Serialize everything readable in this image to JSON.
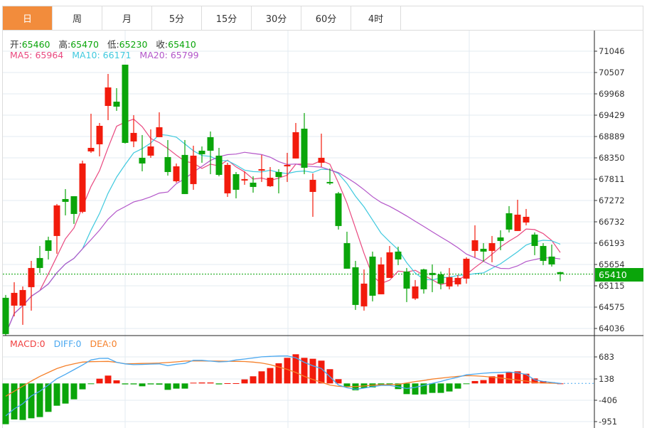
{
  "tabs": [
    "日",
    "周",
    "月",
    "5分",
    "15分",
    "30分",
    "60分",
    "4时"
  ],
  "active_tab": 0,
  "ohlc": {
    "open_label": "开:",
    "open": "65460",
    "high_label": "高:",
    "high": "65470",
    "low_label": "低:",
    "low": "65230",
    "close_label": "收:",
    "close": "65410"
  },
  "ma": {
    "ma5": "MA5: 65964",
    "ma10": "MA10: 66171",
    "ma20": "MA20: 65799"
  },
  "macd_legend": {
    "macd": "MACD:0",
    "diff": "DIFF:0",
    "dea": "DEA:0"
  },
  "current_price": "65410",
  "colors": {
    "up": "#f21b0c",
    "down": "#0aa50a",
    "ma5": "#e9487f",
    "ma10": "#3fc9de",
    "ma20": "#b356c9",
    "diff": "#4aa8f0",
    "dea": "#f5802a",
    "accent": "#f28c3c"
  },
  "chart_data": [
    {
      "type": "candlestick",
      "title": "K-line (daily)",
      "ylim": [
        64036,
        71046
      ],
      "yticks": [
        "71046",
        "70507",
        "69968",
        "69429",
        "68889",
        "68350",
        "67811",
        "67272",
        "66732",
        "66193",
        "65654",
        "65115",
        "64575",
        "64036"
      ],
      "ma_periods": [
        5,
        10,
        20
      ],
      "candles_ochl_note": "each entry [open, close, high, low]",
      "candles": [
        [
          64811,
          63894,
          64883,
          63858
        ],
        [
          64613,
          64936,
          65206,
          64343
        ],
        [
          64613,
          65008,
          65098,
          64128
        ],
        [
          65080,
          65565,
          65745,
          64487
        ],
        [
          65817,
          65565,
          66122,
          65440
        ],
        [
          66266,
          65997,
          66356,
          65781
        ],
        [
          66374,
          67147,
          67183,
          65925
        ],
        [
          67308,
          67237,
          67560,
          66895
        ],
        [
          67380,
          66931,
          67380,
          66679
        ],
        [
          66985,
          68207,
          68279,
          66949
        ],
        [
          68512,
          68602,
          69465,
          68476
        ],
        [
          68692,
          69159,
          69231,
          68387
        ],
        [
          69662,
          70130,
          70471,
          69303
        ],
        [
          69770,
          69644,
          70112,
          69537
        ],
        [
          70705,
          68728,
          70705,
          68710
        ],
        [
          68764,
          68980,
          69429,
          68620
        ],
        [
          68351,
          68207,
          68926,
          68009
        ],
        [
          68405,
          68638,
          69069,
          68351
        ],
        [
          68872,
          69123,
          69501,
          68872
        ],
        [
          68369,
          67991,
          68800,
          67901
        ],
        [
          67758,
          68135,
          68207,
          67722
        ],
        [
          68423,
          67434,
          68800,
          67434
        ],
        [
          67686,
          68405,
          68656,
          67542
        ],
        [
          68530,
          68441,
          68638,
          68225
        ],
        [
          68872,
          68530,
          69016,
          67937
        ],
        [
          68405,
          67919,
          68602,
          67883
        ],
        [
          67452,
          68171,
          68225,
          67362
        ],
        [
          67937,
          67542,
          67991,
          67326
        ],
        [
          67776,
          67812,
          68009,
          67668
        ],
        [
          67722,
          67614,
          67883,
          67470
        ],
        [
          68027,
          68063,
          68423,
          67740
        ],
        [
          67632,
          67847,
          68117,
          67614
        ],
        [
          67991,
          67865,
          68063,
          67452
        ],
        [
          68135,
          68171,
          68476,
          67740
        ],
        [
          68333,
          68998,
          69231,
          68333
        ],
        [
          69087,
          68099,
          69483,
          67937
        ],
        [
          67488,
          67794,
          67955,
          66859
        ],
        [
          68225,
          68351,
          68962,
          68117
        ],
        [
          67740,
          67704,
          68081,
          67668
        ],
        [
          67452,
          66626,
          67488,
          66536
        ],
        [
          66194,
          65547,
          66482,
          65547
        ],
        [
          65583,
          64631,
          65745,
          64505
        ],
        [
          64595,
          65170,
          65529,
          64487
        ],
        [
          65853,
          64864,
          65979,
          64721
        ],
        [
          64900,
          65655,
          65835,
          64900
        ],
        [
          65314,
          65961,
          66122,
          65314
        ],
        [
          65979,
          65781,
          66104,
          65637
        ],
        [
          65475,
          65044,
          65565,
          64703
        ],
        [
          64793,
          65098,
          65260,
          64757
        ],
        [
          65529,
          65026,
          65547,
          64918
        ],
        [
          65440,
          65386,
          65655,
          64954
        ],
        [
          65404,
          65170,
          65475,
          65026
        ],
        [
          65098,
          65332,
          65565,
          65026
        ],
        [
          65152,
          65314,
          65386,
          65098
        ],
        [
          65296,
          65799,
          65835,
          65170
        ],
        [
          65997,
          66266,
          66644,
          65835
        ],
        [
          66050,
          65979,
          66194,
          65727
        ],
        [
          65997,
          66194,
          66374,
          65709
        ],
        [
          66338,
          66248,
          66518,
          66015
        ],
        [
          66949,
          66536,
          67129,
          66464
        ],
        [
          66500,
          66913,
          67290,
          66500
        ],
        [
          66715,
          66859,
          67057,
          66644
        ],
        [
          66410,
          66122,
          66464,
          65889
        ],
        [
          66122,
          65745,
          66194,
          65637
        ],
        [
          65853,
          65655,
          66158,
          65601
        ],
        [
          65460,
          65410,
          65470,
          65230
        ]
      ]
    },
    {
      "type": "macd",
      "ylim": [
        -951,
        683
      ],
      "yticks": [
        "683",
        "138",
        "-406",
        "-951"
      ],
      "histogram": [
        -1042,
        -921,
        -933,
        -891,
        -860,
        -727,
        -570,
        -515,
        -406,
        -151,
        -12,
        121,
        200,
        79,
        -24,
        -24,
        -73,
        -24,
        -30,
        -164,
        -133,
        -133,
        18,
        24,
        24,
        -24,
        6,
        6,
        103,
        182,
        309,
        394,
        515,
        654,
        745,
        654,
        630,
        582,
        364,
        109,
        -85,
        -176,
        -115,
        -103,
        -30,
        -30,
        -145,
        -273,
        -285,
        -279,
        -242,
        -242,
        -206,
        -133,
        -12,
        61,
        85,
        182,
        230,
        291,
        309,
        248,
        127,
        61,
        30,
        0
      ],
      "diff": [
        -830,
        -650,
        -520,
        -320,
        -200,
        -40,
        120,
        230,
        350,
        470,
        600,
        640,
        642,
        540,
        500,
        480,
        485,
        495,
        500,
        455,
        490,
        510,
        590,
        590,
        570,
        551,
        560,
        600,
        624,
        650,
        680,
        690,
        700,
        703,
        654,
        540,
        450,
        382,
        170,
        -40,
        -110,
        -151,
        -120,
        -85,
        -50,
        -50,
        -85,
        -130,
        -100,
        -50,
        0,
        50,
        109,
        160,
        220,
        240,
        260,
        275,
        282,
        291,
        270,
        230,
        90,
        50,
        25,
        0
      ],
      "dea": [
        -327,
        -200,
        -70,
        60,
        180,
        280,
        380,
        450,
        500,
        545,
        555,
        560,
        563,
        540,
        503,
        505,
        510,
        515,
        521,
        535,
        550,
        570,
        576,
        574,
        572,
        570,
        567,
        564,
        560,
        545,
        521,
        480,
        420,
        360,
        280,
        180,
        100,
        30,
        -42,
        -75,
        -85,
        -80,
        -65,
        -45,
        -35,
        -30,
        -24,
        10,
        48,
        75,
        110,
        135,
        160,
        180,
        200,
        195,
        180,
        160,
        140,
        110,
        85,
        60,
        20,
        10,
        5,
        0
      ]
    }
  ]
}
